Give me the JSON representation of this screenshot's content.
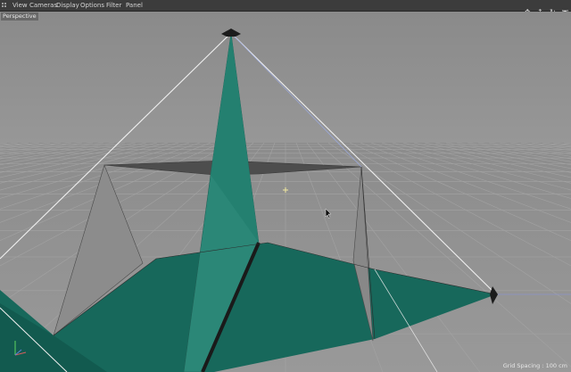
{
  "menu": {
    "items": [
      "View",
      "Cameras",
      "Display",
      "Options",
      "Filter",
      "Panel"
    ]
  },
  "nav_icons": [
    "move-view-icon",
    "zoom-view-icon",
    "rotate-view-icon",
    "toggle-layout-icon"
  ],
  "viewport": {
    "view_name": "Perspective",
    "grid_spacing": "Grid Spacing : 100 cm"
  },
  "colors": {
    "menubar": "#3c3c3c",
    "viewport_bg": "#8f8f8f",
    "grid_line": "#9c9c9c",
    "object_teal": "#176b5e",
    "object_teal_light": "#2a8a78",
    "object_gray": "#8a8a8a",
    "gizmo_line": "#e8e8e8",
    "gizmo_blue": "#9aa7d8"
  }
}
